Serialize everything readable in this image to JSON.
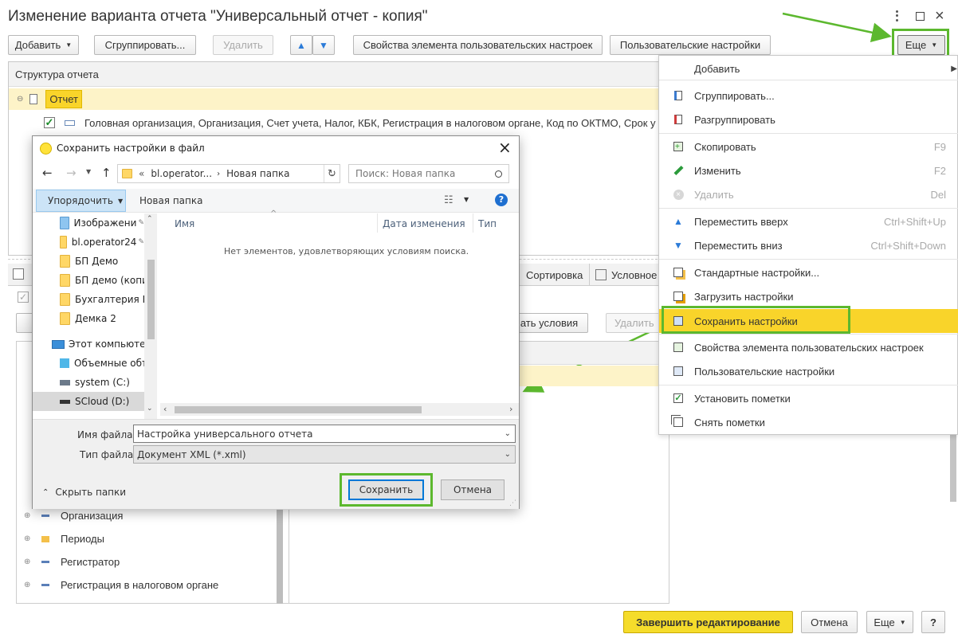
{
  "window": {
    "title": "Изменение варианта отчета \"Универсальный отчет - копия\""
  },
  "toolbar": {
    "add": "Добавить",
    "group": "Сгруппировать...",
    "delete": "Удалить",
    "element_props": "Свойства элемента пользовательских настроек",
    "user_settings": "Пользовательские настройки",
    "more": "Еще"
  },
  "structure": {
    "header": "Структура отчета",
    "root": "Отчет",
    "row1": "Головная организация, Организация, Счет учета, Налог, КБК, Регистрация в налоговом органе, Код по ОКТМО, Срок у"
  },
  "lower_tabs": {
    "sort": "Сортировка",
    "cond": "Условное",
    "cond_btn_text": "ать условия",
    "delete": "Удалить"
  },
  "fields_tree": {
    "items": [
      "Организация",
      "Периоды",
      "Регистратор",
      "Регистрация в налоговом органе"
    ]
  },
  "context_menu": {
    "items": [
      {
        "label": "Добавить",
        "shortcut": "",
        "icon": "none"
      },
      {
        "label": "Сгруппировать...",
        "shortcut": "",
        "icon": "group-icon"
      },
      {
        "label": "Разгруппировать",
        "shortcut": "",
        "icon": "ungroup-icon"
      },
      {
        "label": "Скопировать",
        "shortcut": "F9",
        "icon": "copy-icon"
      },
      {
        "label": "Изменить",
        "shortcut": "F2",
        "icon": "pencil-icon"
      },
      {
        "label": "Удалить",
        "shortcut": "Del",
        "icon": "delete-icon"
      },
      {
        "label": "Переместить вверх",
        "shortcut": "Ctrl+Shift+Up",
        "icon": "arrow-up-icon"
      },
      {
        "label": "Переместить вниз",
        "shortcut": "Ctrl+Shift+Down",
        "icon": "arrow-down-icon"
      },
      {
        "label": "Стандартные настройки...",
        "shortcut": "",
        "icon": "standard-settings-icon"
      },
      {
        "label": "Загрузить настройки",
        "shortcut": "",
        "icon": "load-settings-icon"
      },
      {
        "label": "Сохранить настройки",
        "shortcut": "",
        "icon": "save-settings-icon"
      },
      {
        "label": "Свойства элемента пользовательских настроек",
        "shortcut": "",
        "icon": "element-props-icon"
      },
      {
        "label": "Пользовательские настройки",
        "shortcut": "",
        "icon": "user-settings-icon"
      },
      {
        "label": "Установить пометки",
        "shortcut": "",
        "icon": "check-all-icon"
      },
      {
        "label": "Снять пометки",
        "shortcut": "",
        "icon": "uncheck-all-icon"
      }
    ]
  },
  "dialog": {
    "title": "Сохранить настройки в файл",
    "path_prefix": "«",
    "path_1": "bl.operator...",
    "path_2": "Новая папка",
    "search_placeholder": "Поиск: Новая папка",
    "organize": "Упорядочить",
    "new_folder": "Новая папка",
    "nav_items": [
      "Изображени",
      "bl.operator24",
      "БП Демо",
      "БП демо (копия",
      "Бухгалтерия ПР",
      "Демка 2",
      "Этот компьютер",
      "Объемные объе",
      "system (C:)",
      "SCloud (D:)"
    ],
    "col_name": "Имя",
    "col_date": "Дата изменения",
    "col_type": "Тип",
    "empty_msg": "Нет элементов, удовлетворяющих условиям поиска.",
    "file_name_label": "Имя файла:",
    "file_name_value": "Настройка универсального отчета",
    "file_type_label": "Тип файла:",
    "file_type_value": "Документ XML (*.xml)",
    "hide_folders": "Скрыть папки",
    "save": "Сохранить",
    "cancel": "Отмена"
  },
  "bottom_bar": {
    "finish": "Завершить редактирование",
    "cancel": "Отмена",
    "more": "Еще",
    "help": "?"
  },
  "colors": {
    "accent_yellow": "#f9d42a",
    "highlight_row": "#fdf3c8",
    "green_frame": "#5cb82e",
    "primary_btn": "#f5dc2b"
  }
}
